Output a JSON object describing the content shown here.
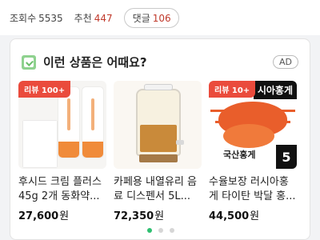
{
  "stats": {
    "views_label": "조회수",
    "views_value": "5535",
    "likes_label": "추천",
    "likes_value": "447",
    "comments_label": "댓글",
    "comments_value": "106"
  },
  "recommend": {
    "title": "이런 상품은 어때요?",
    "ad_label": "AD",
    "items": [
      {
        "badge": "리뷰 100+",
        "name": "후시드 크림 플러스 45g 2개 동화약...",
        "price": "27,600",
        "currency": "원"
      },
      {
        "badge": "",
        "name": "카페용 내열유리 음료 디스펜서 5L...",
        "price": "72,350",
        "currency": "원"
      },
      {
        "badge": "리뷰 10+",
        "image_top_text": "시아홍게",
        "image_bottom_text": "국산홍게",
        "image_corner_text": "5",
        "name": "수율보장 러시아홍게 타이탄 박달 홍...",
        "price": "44,500",
        "currency": "원"
      }
    ]
  },
  "carousel": {
    "pages": 3,
    "active": 1
  },
  "colors": {
    "accent_green": "#2fbf71",
    "badge_red": "#ea4b3c",
    "stat_red": "#c0392b"
  }
}
